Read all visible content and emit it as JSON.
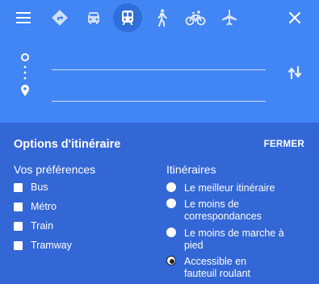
{
  "colors": {
    "header_bg": "#4285f4",
    "active_mode_bg": "#2f6fd8",
    "panel_bg": "#3367d6",
    "text": "#ffffff"
  },
  "travel_modes": [
    {
      "name": "menu-icon"
    },
    {
      "name": "directions-icon"
    },
    {
      "name": "car-icon"
    },
    {
      "name": "transit-icon",
      "selected": true
    },
    {
      "name": "walk-icon"
    },
    {
      "name": "bike-icon"
    },
    {
      "name": "plane-icon"
    },
    {
      "name": "close-icon"
    }
  ],
  "route": {
    "origin_value": "",
    "destination_value": "",
    "swap_icon": "swap-icon"
  },
  "options": {
    "title": "Options d'itinéraire",
    "close_label": "FERMER",
    "preferences": {
      "title": "Vos préférences",
      "items": [
        {
          "label": "Bus",
          "checked": false
        },
        {
          "label": "Métro",
          "checked": false
        },
        {
          "label": "Train",
          "checked": false
        },
        {
          "label": "Tramway",
          "checked": false
        }
      ]
    },
    "itineraries": {
      "title": "Itinéraires",
      "items": [
        {
          "label": "Le meilleur itinéraire",
          "selected": false
        },
        {
          "label": "Le moins de correspondances",
          "selected": false
        },
        {
          "label": "Le moins de marche à pied",
          "selected": false
        },
        {
          "label": "Accessible en fauteuil roulant",
          "selected": true
        }
      ]
    }
  }
}
